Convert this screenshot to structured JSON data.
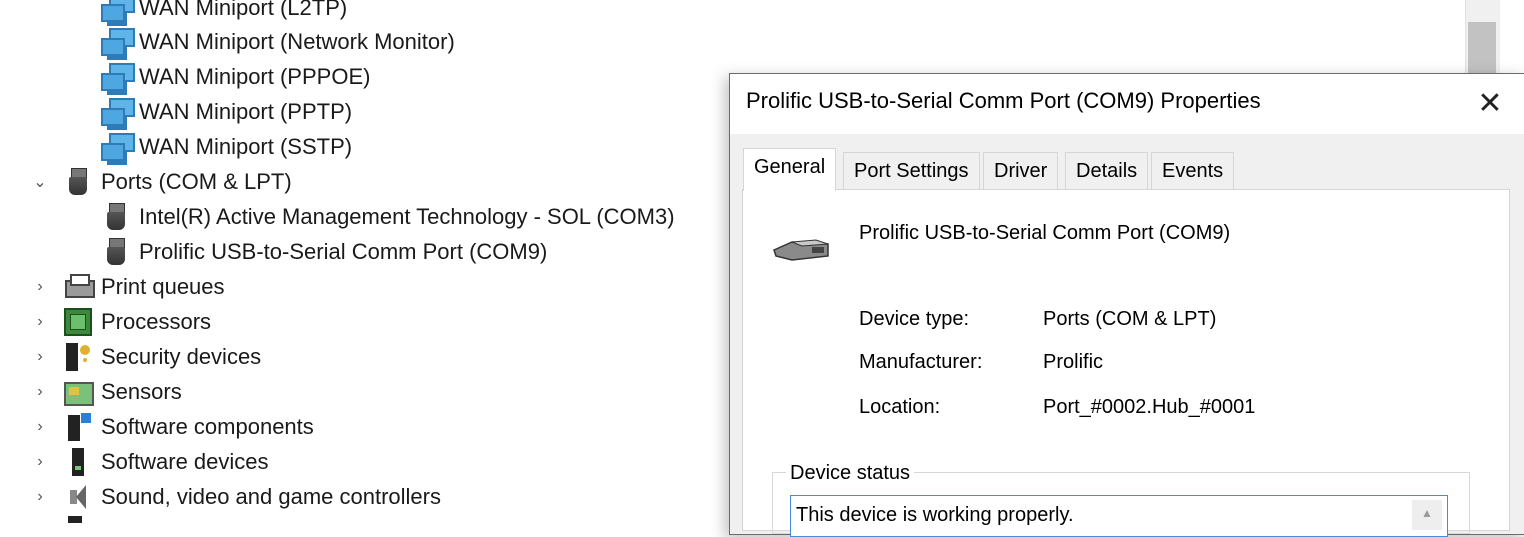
{
  "tree": {
    "items": [
      {
        "label": "WAN Miniport (L2TP)",
        "icon": "network-adapter-icon"
      },
      {
        "label": "WAN Miniport (Network Monitor)",
        "icon": "network-adapter-icon"
      },
      {
        "label": "WAN Miniport (PPPOE)",
        "icon": "network-adapter-icon"
      },
      {
        "label": "WAN Miniport (PPTP)",
        "icon": "network-adapter-icon"
      },
      {
        "label": "WAN Miniport (SSTP)",
        "icon": "network-adapter-icon"
      },
      {
        "label": "Ports (COM & LPT)",
        "icon": "port-icon",
        "expanded": true
      },
      {
        "label": "Intel(R) Active Management Technology - SOL (COM3)",
        "icon": "port-icon"
      },
      {
        "label": "Prolific USB-to-Serial Comm Port (COM9)",
        "icon": "port-icon"
      },
      {
        "label": "Print queues",
        "icon": "printer-icon"
      },
      {
        "label": "Processors",
        "icon": "processor-icon"
      },
      {
        "label": "Security devices",
        "icon": "security-device-icon"
      },
      {
        "label": "Sensors",
        "icon": "sensor-icon"
      },
      {
        "label": "Software components",
        "icon": "software-component-icon"
      },
      {
        "label": "Software devices",
        "icon": "software-device-icon"
      },
      {
        "label": "Sound, video and game controllers",
        "icon": "speaker-icon"
      }
    ]
  },
  "dialog": {
    "title": "Prolific USB-to-Serial Comm Port (COM9) Properties",
    "close_icon": "close-icon",
    "tabs": [
      {
        "label": "General",
        "active": true
      },
      {
        "label": "Port Settings"
      },
      {
        "label": "Driver"
      },
      {
        "label": "Details"
      },
      {
        "label": "Events"
      }
    ],
    "general": {
      "device_name": "Prolific USB-to-Serial Comm Port (COM9)",
      "device_type_label": "Device type:",
      "device_type_value": "Ports (COM & LPT)",
      "manufacturer_label": "Manufacturer:",
      "manufacturer_value": "Prolific",
      "location_label": "Location:",
      "location_value": "Port_#0002.Hub_#0001",
      "status_group_label": "Device status",
      "status_text": "This device is working properly."
    }
  },
  "colors": {
    "dialog_bg": "#f0f0f0",
    "accent_border": "#4a8ad8"
  }
}
